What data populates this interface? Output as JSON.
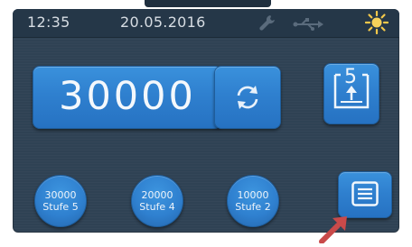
{
  "statusbar": {
    "time": "12:35",
    "date": "20.05.2016",
    "icons": [
      "wrench-icon",
      "usb-icon",
      "sun-icon"
    ],
    "sun_color": "#f3c84a"
  },
  "counter": {
    "value": "30000"
  },
  "reset_icon": "refresh-icon",
  "stack_button": {
    "icon": "stack-output-icon",
    "number": "5"
  },
  "levels": [
    {
      "line1": "30000",
      "line2": "Stufe 5"
    },
    {
      "line1": "20000",
      "line2": "Stufe 4"
    },
    {
      "line1": "10000",
      "line2": "Stufe 2"
    }
  ],
  "menu_icon": "list-icon",
  "accent_color": "#2f80cf",
  "pointer_color": "#c94a4a"
}
